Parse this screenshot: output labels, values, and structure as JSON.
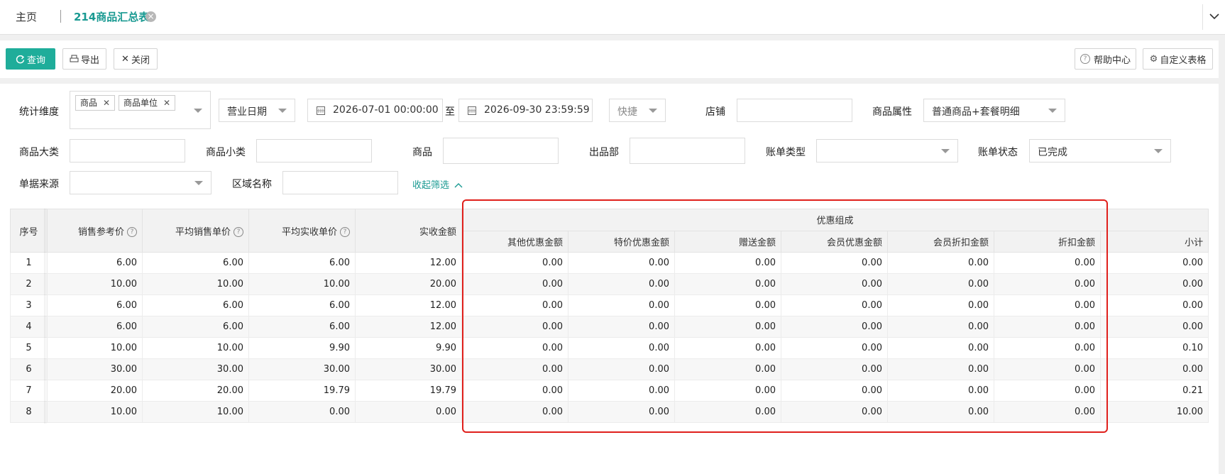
{
  "tabs": {
    "home": "主页",
    "active": "214商品汇总表"
  },
  "toolbar": {
    "query": "查询",
    "export": "导出",
    "close": "关闭",
    "help_center": "帮助中心",
    "custom_table": "自定义表格"
  },
  "filters": {
    "dimension_label": "统计维度",
    "dimension_tags": [
      "商品",
      "商品单位"
    ],
    "date_type": "营业日期",
    "date_start": "2026-07-01 00:00:00",
    "date_to": "至",
    "date_end": "2026-09-30 23:59:59",
    "shortcut": "快捷",
    "store_label": "店铺",
    "attr_label": "商品属性",
    "attr_value": "普通商品+套餐明细",
    "major_cat_label": "商品大类",
    "minor_cat_label": "商品小类",
    "goods_label": "商品",
    "dept_label": "出品部",
    "bill_type_label": "账单类型",
    "bill_status_label": "账单状态",
    "bill_status_value": "已完成",
    "source_label": "单据来源",
    "area_label": "区域名称",
    "collapse": "收起筛选"
  },
  "table": {
    "headers": {
      "index": "序号",
      "ref_price": "销售参考价",
      "avg_price": "平均销售单价",
      "avg_actual": "平均实收单价",
      "actual_amount": "实收金额",
      "discount_group": "优惠组成",
      "other_discount": "其他优惠金额",
      "special_discount": "特价优惠金额",
      "gift_amount": "赠送金额",
      "member_discount": "会员优惠金额",
      "member_rebate": "会员折扣金额",
      "rebate": "折扣金额",
      "subtotal": "小计"
    },
    "rows": [
      [
        "1",
        "6.00",
        "6.00",
        "6.00",
        "12.00",
        "0.00",
        "0.00",
        "0.00",
        "0.00",
        "0.00",
        "0.00",
        "0.00"
      ],
      [
        "2",
        "10.00",
        "10.00",
        "10.00",
        "20.00",
        "0.00",
        "0.00",
        "0.00",
        "0.00",
        "0.00",
        "0.00",
        "0.00"
      ],
      [
        "3",
        "6.00",
        "6.00",
        "6.00",
        "12.00",
        "0.00",
        "0.00",
        "0.00",
        "0.00",
        "0.00",
        "0.00",
        "0.00"
      ],
      [
        "4",
        "6.00",
        "6.00",
        "6.00",
        "12.00",
        "0.00",
        "0.00",
        "0.00",
        "0.00",
        "0.00",
        "0.00",
        "0.00"
      ],
      [
        "5",
        "10.00",
        "10.00",
        "9.90",
        "9.90",
        "0.00",
        "0.00",
        "0.00",
        "0.00",
        "0.00",
        "0.00",
        "0.10"
      ],
      [
        "6",
        "30.00",
        "30.00",
        "30.00",
        "30.00",
        "0.00",
        "0.00",
        "0.00",
        "0.00",
        "0.00",
        "0.00",
        "0.00"
      ],
      [
        "7",
        "20.00",
        "20.00",
        "19.79",
        "19.79",
        "0.00",
        "0.00",
        "0.00",
        "0.00",
        "0.00",
        "0.00",
        "0.21"
      ],
      [
        "8",
        "10.00",
        "10.00",
        "0.00",
        "0.00",
        "0.00",
        "0.00",
        "0.00",
        "0.00",
        "0.00",
        "0.00",
        "10.00"
      ]
    ]
  },
  "colors": {
    "accent": "#1fad9a",
    "highlight": "#e0201c"
  }
}
